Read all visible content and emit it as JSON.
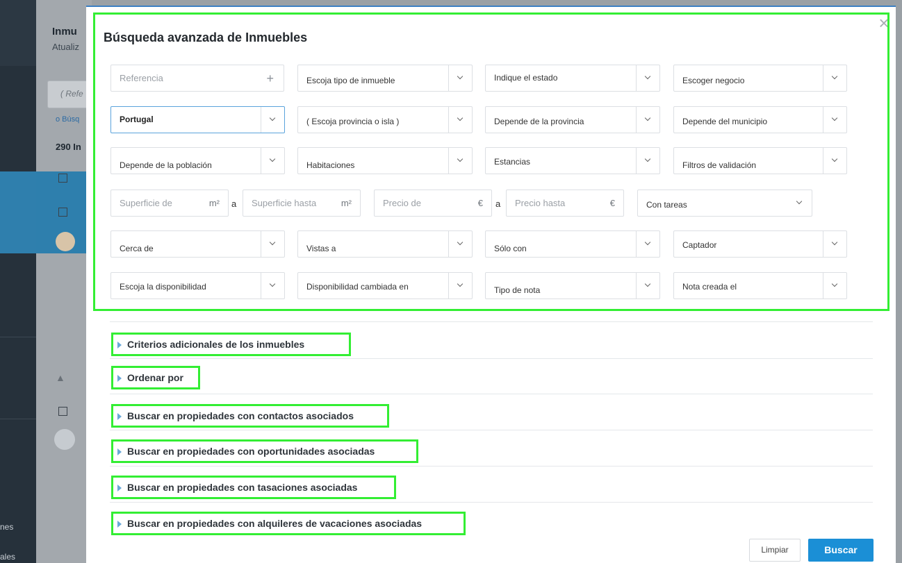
{
  "background": {
    "page_title": "Inmu",
    "page_subtitle": "Atualiz",
    "search_placeholder": "( Refe",
    "search_link": "o Búsq",
    "result_count": "290 In",
    "sidebar_labels": [
      "nes",
      "ales"
    ]
  },
  "modal": {
    "title": "Búsqueda avanzada de Inmuebles",
    "close_symbol": "×",
    "rows": [
      {
        "fields": [
          {
            "label": "Referencia",
            "placeholder": true,
            "icon": "+"
          },
          {
            "label": "Escoja tipo de inmueble"
          },
          {
            "label": "Indique el estado"
          },
          {
            "label": "Escoger negocio"
          }
        ]
      },
      {
        "fields": [
          {
            "label": "Portugal",
            "bold": true
          },
          {
            "label": "( Escoja provincia o isla )"
          },
          {
            "label": "Depende de la provincia"
          },
          {
            "label": "Depende del municipio"
          }
        ]
      },
      {
        "fields": [
          {
            "label": "Depende de la población"
          },
          {
            "label": "Habitaciones"
          },
          {
            "label": "Estancias"
          },
          {
            "label": "Filtros de validación"
          }
        ]
      },
      {
        "fields": [
          {
            "label": "Superficie de",
            "unit": "m²"
          },
          {
            "label": "Superficie hasta",
            "unit": "m²"
          },
          {
            "label": "Precio de",
            "unit": "€"
          },
          {
            "label": "Precio hasta",
            "unit": "€"
          },
          {
            "label": "Con tareas"
          }
        ],
        "separator": "a"
      },
      {
        "fields": [
          {
            "label": "Cerca de"
          },
          {
            "label": "Vistas a"
          },
          {
            "label": "Sólo con"
          },
          {
            "label": "Captador"
          }
        ]
      },
      {
        "fields": [
          {
            "label": "Escoja la disponibilidad"
          },
          {
            "label": "Disponibilidad cambiada en"
          },
          {
            "label": "Tipo de nota"
          },
          {
            "label": "Nota creada el"
          }
        ]
      }
    ],
    "sections": [
      "Criterios adicionales de los inmuebles",
      "Ordenar por",
      "Buscar en propiedades con contactos asociados",
      "Buscar en propiedades con oportunidades asociadas",
      "Buscar en propiedades con tasaciones asociadas",
      "Buscar en propiedades con alquileres de vacaciones asociadas"
    ],
    "buttons": {
      "clear": "Limpiar",
      "search": "Buscar"
    }
  },
  "colors": {
    "primary": "#1b8fd6",
    "highlight_box": "#33ee33",
    "section_arrow": "#6aa8d8"
  }
}
